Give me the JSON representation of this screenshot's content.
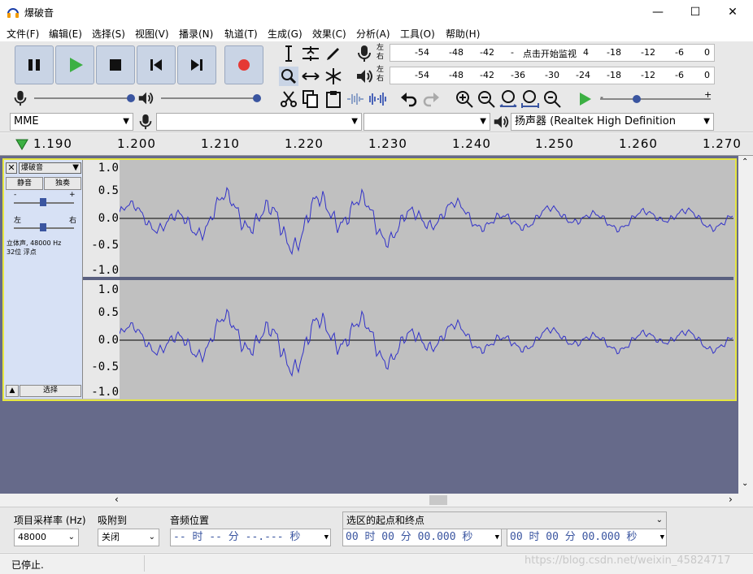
{
  "window": {
    "title": "爆破音"
  },
  "menus": [
    "文件(F)",
    "编辑(E)",
    "选择(S)",
    "视图(V)",
    "播录(N)",
    "轨道(T)",
    "生成(G)",
    "效果(C)",
    "分析(A)",
    "工具(O)",
    "帮助(H)"
  ],
  "meters": {
    "record_ticks": [
      "-54",
      "-48",
      "-42",
      "-",
      "点击开始监视",
      "4",
      "-18",
      "-12",
      "-6",
      "0"
    ],
    "play_ticks": [
      "-54",
      "-48",
      "-42",
      "-36",
      "-30",
      "-24",
      "-18",
      "-12",
      "-6",
      "0"
    ],
    "lr_top": "左\n右",
    "left": "左",
    "right": "右"
  },
  "devices": {
    "host": "MME",
    "record_device": "",
    "channels": "",
    "playback_device": "扬声器 (Realtek High Definition"
  },
  "ruler": {
    "ticks": [
      "1.190",
      "1.200",
      "1.210",
      "1.220",
      "1.230",
      "1.240",
      "1.250",
      "1.260",
      "1.270"
    ]
  },
  "track": {
    "name": "爆破音",
    "mute": "静音",
    "solo": "独奏",
    "gain_minus": "-",
    "gain_plus": "+",
    "pan_left": "左",
    "pan_right": "右",
    "info1": "立体声, 48000 Hz",
    "info2": "32位 浮点",
    "select": "选择",
    "yticks": [
      "1.0",
      "0.5",
      "0.0",
      "-0.5",
      "-1.0"
    ]
  },
  "selection_toolbar": {
    "rate_label": "项目采样率 (Hz)",
    "rate_value": "48000",
    "snap_label": "吸附到",
    "snap_value": "关闭",
    "audio_pos_label": "音频位置",
    "audio_pos_value": "-- 时 -- 分 --.--- 秒",
    "sel_label": "选区的起点和终点",
    "sel_start": "00 时 00 分 00.000 秒",
    "sel_end": "00 时 00 分 00.000 秒"
  },
  "status": {
    "text": "已停止.",
    "watermark": "https://blog.csdn.net/weixin_45824717"
  },
  "colors": {
    "accent": "#3a55a0",
    "wave": "#3232c8",
    "track_border": "#e6e640"
  }
}
